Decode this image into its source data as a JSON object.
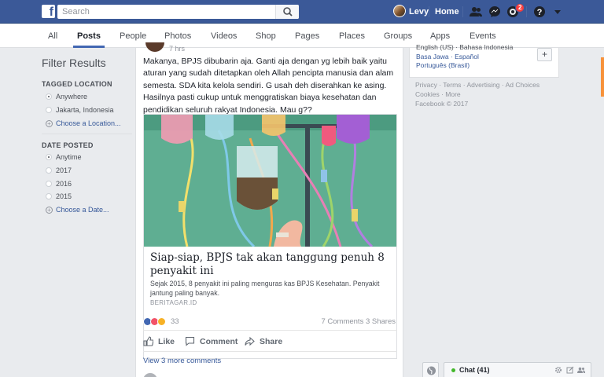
{
  "topbar": {
    "logo": "f",
    "search_placeholder": "Search",
    "user_name": "Levy",
    "home_label": "Home",
    "notification_count": "2",
    "icons": [
      "search-icon",
      "friends-icon",
      "messenger-icon",
      "notifications-icon",
      "help-icon",
      "dropdown-icon"
    ]
  },
  "tabs": [
    {
      "label": "All",
      "active": false
    },
    {
      "label": "Posts",
      "active": true
    },
    {
      "label": "People",
      "active": false
    },
    {
      "label": "Photos",
      "active": false
    },
    {
      "label": "Videos",
      "active": false
    },
    {
      "label": "Shop",
      "active": false
    },
    {
      "label": "Pages",
      "active": false
    },
    {
      "label": "Places",
      "active": false
    },
    {
      "label": "Groups",
      "active": false
    },
    {
      "label": "Apps",
      "active": false
    },
    {
      "label": "Events",
      "active": false
    }
  ],
  "filters": {
    "title": "Filter Results",
    "tagged_location": {
      "heading": "TAGGED LOCATION",
      "options": [
        "Anywhere",
        "Jakarta, Indonesia"
      ],
      "selected": "Anywhere",
      "choose": "Choose a Location..."
    },
    "date_posted": {
      "heading": "DATE POSTED",
      "options": [
        "Anytime",
        "2017",
        "2016",
        "2015"
      ],
      "selected": "Anytime",
      "choose": "Choose a Date..."
    }
  },
  "post": {
    "time": "7 hrs",
    "text": "Makanya, BPJS dibubarin aja. Ganti aja dengan yg lebih baik yaitu aturan yang sudah ditetapkan oleh Allah pencipta manusia dan alam semesta. SDA kita kelola sendiri. G usah deh diserahkan ke asing. Hasilnya pasti cukup untuk menggratiskan biaya kesehatan dan pendidikan seluruh rakyat Indonesia. Mau g??",
    "link": {
      "title": "Siap-siap, BPJS tak akan tanggung penuh 8 penyakit ini",
      "description": "Sejak 2015, 8 penyakit ini paling menguras kas BPJS Kesehatan. Penyakit jantung paling banyak.",
      "domain": "BERITAGAR.ID"
    },
    "reaction_count": "33",
    "comments": "7 Comments",
    "shares": "3 Shares",
    "actions": {
      "like": "Like",
      "comment": "Comment",
      "share": "Share"
    },
    "more_comments": "View 3 more comments"
  },
  "right": {
    "languages_line1": "English (US) · Bahasa Indonesia",
    "languages_line2": "Basa Jawa · Español",
    "languages_line3": "Português (Brasil)",
    "add_language": "+",
    "footer_line1": "Privacy · Terms · Advertising · Ad Choices",
    "footer_line2": "Cookies · More",
    "footer_line3": "Facebook © 2017"
  },
  "chat": {
    "label": "Chat (41)",
    "status_color": "#42b72a"
  },
  "colors": {
    "brand": "#3b5998",
    "link": "#365899",
    "tab_accent": "#4267b2",
    "badge": "#fa3e3e"
  }
}
